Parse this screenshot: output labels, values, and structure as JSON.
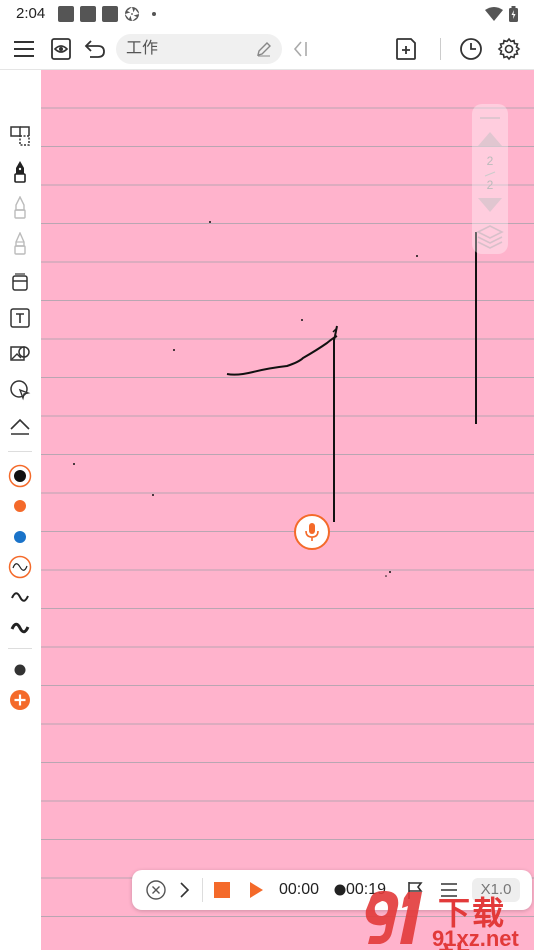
{
  "status_bar": {
    "time": "2:04"
  },
  "toolbar": {
    "title": "工作"
  },
  "page_nav": {
    "current": "2",
    "total": "2"
  },
  "recording": {
    "elapsed": "00:00",
    "total": "00:19",
    "speed": "X1.0"
  },
  "colors": {
    "canvas_bg": "#ffb3cc",
    "accent": "#f46a2a",
    "pen_black": "#111111",
    "pen_orange": "#f46a2a",
    "pen_blue": "#1a73c9",
    "add_color": "#f46a2a"
  },
  "watermark": {
    "text_cn": "下载站",
    "url": "91xz.net"
  }
}
